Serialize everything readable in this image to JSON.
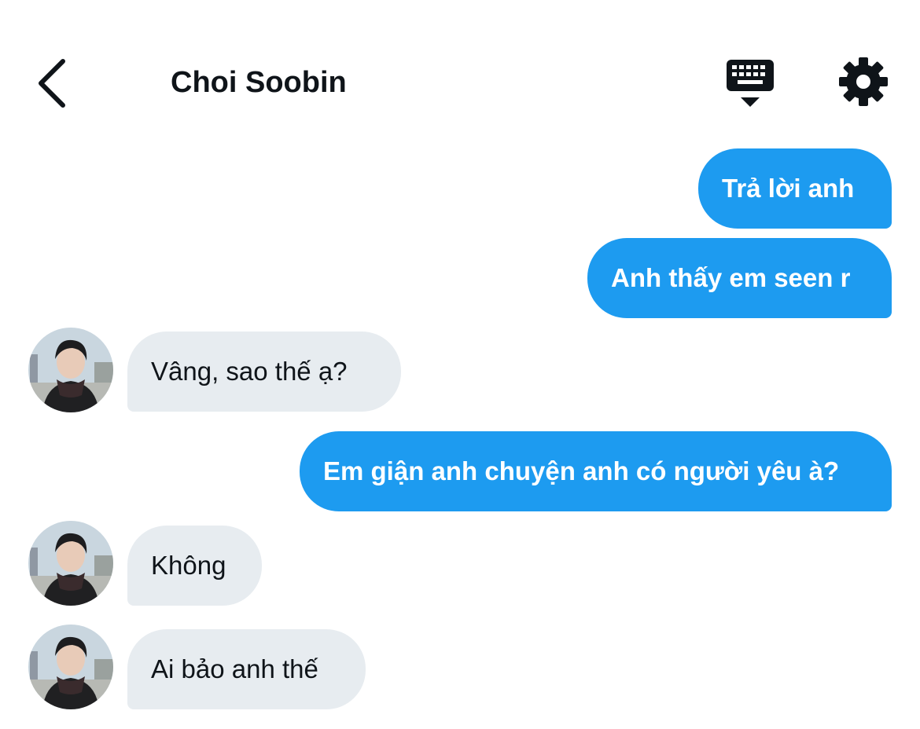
{
  "header": {
    "title": "Choi Soobin",
    "back_icon": "chevron-left-icon",
    "keyboard_icon": "keyboard-dismiss-icon",
    "settings_icon": "gear-icon"
  },
  "colors": {
    "outgoing_bubble": "#1d9bf0",
    "incoming_bubble": "#e7ecf0",
    "text_dark": "#0f1419"
  },
  "messages": [
    {
      "direction": "outgoing",
      "text": "Trả lời anh"
    },
    {
      "direction": "outgoing",
      "text": "Anh thấy em seen r"
    },
    {
      "direction": "incoming",
      "text": "Vâng, sao thế ạ?"
    },
    {
      "direction": "outgoing",
      "text": "Em giận anh chuyện anh có người yêu à?"
    },
    {
      "direction": "incoming",
      "text": "Không"
    },
    {
      "direction": "incoming",
      "text": "Ai bảo anh thế"
    }
  ]
}
